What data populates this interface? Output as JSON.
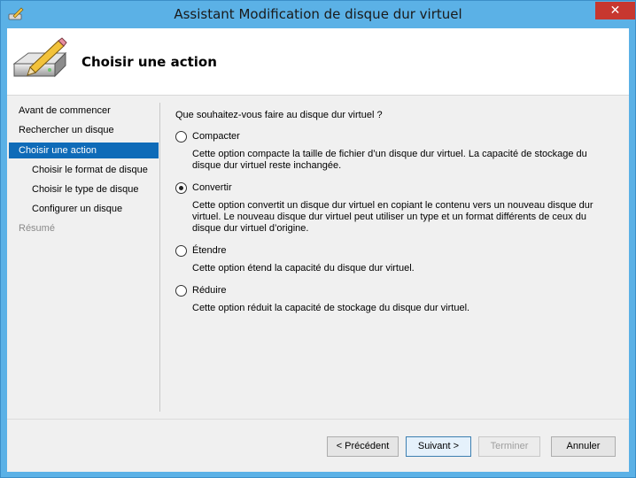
{
  "window": {
    "title": "Assistant Modification de disque dur virtuel",
    "close_glyph": "✕"
  },
  "header": {
    "title": "Choisir une action",
    "icon": "disk-pencil-icon"
  },
  "nav": {
    "items": [
      {
        "label": "Avant de commencer",
        "state": "normal"
      },
      {
        "label": "Rechercher un disque",
        "state": "normal"
      },
      {
        "label": "Choisir une action",
        "state": "active"
      },
      {
        "label": "Choisir le format de disque",
        "state": "sub"
      },
      {
        "label": "Choisir le type de disque",
        "state": "sub"
      },
      {
        "label": "Configurer un disque",
        "state": "sub"
      },
      {
        "label": "Résumé",
        "state": "disabled"
      }
    ]
  },
  "content": {
    "question": "Que souhaitez-vous faire au disque dur virtuel ?",
    "options": [
      {
        "label": "Compacter",
        "checked": false,
        "desc": "Cette option compacte la taille de fichier d’un disque dur virtuel. La capacité de stockage du disque dur virtuel reste inchangée."
      },
      {
        "label": "Convertir",
        "checked": true,
        "desc": "Cette option convertit un disque dur virtuel en copiant le contenu vers un nouveau disque dur virtuel. Le nouveau disque dur virtuel peut utiliser un type et un format différents de ceux du disque dur virtuel d’origine."
      },
      {
        "label": "Étendre",
        "checked": false,
        "desc": "Cette option étend la capacité du disque dur virtuel."
      },
      {
        "label": "Réduire",
        "checked": false,
        "desc": "Cette option réduit la capacité de stockage du disque dur virtuel."
      }
    ]
  },
  "footer": {
    "previous": "< Précédent",
    "next": "Suivant >",
    "finish": "Terminer",
    "cancel": "Annuler"
  },
  "colors": {
    "titlebar": "#5bb1e6",
    "nav_active": "#0f6bb8",
    "close_button": "#c7372f"
  }
}
